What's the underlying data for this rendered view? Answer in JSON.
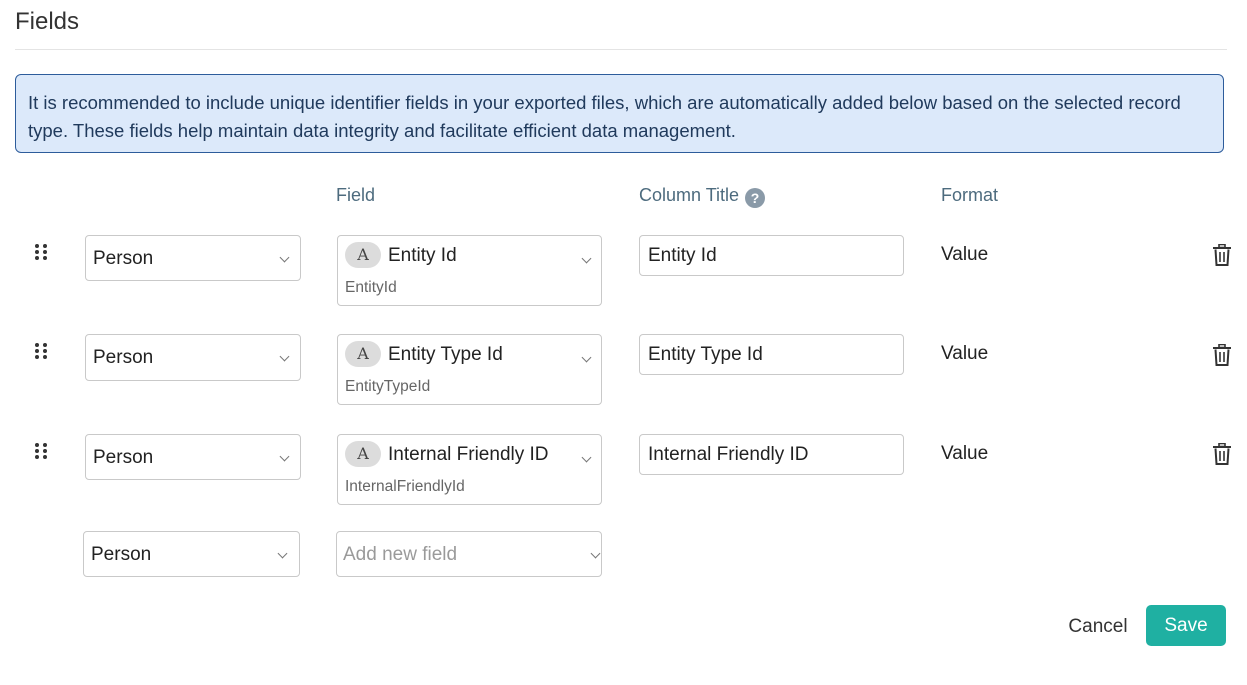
{
  "page_title": "Fields",
  "info_message": "It is recommended to include unique identifier fields in your exported files, which are automatically added below based on the selected record type. These fields help maintain data integrity and facilitate efficient data management.",
  "headers": {
    "field": "Field",
    "column_title": "Column Title",
    "format": "Format"
  },
  "rows": [
    {
      "record_type": "Person",
      "type_badge": "A",
      "field_label": "Entity Id",
      "field_key": "EntityId",
      "column_title": "Entity Id",
      "format": "Value"
    },
    {
      "record_type": "Person",
      "type_badge": "A",
      "field_label": "Entity Type Id",
      "field_key": "EntityTypeId",
      "column_title": "Entity Type Id",
      "format": "Value"
    },
    {
      "record_type": "Person",
      "type_badge": "A",
      "field_label": "Internal Friendly ID",
      "field_key": "InternalFriendlyId",
      "column_title": "Internal Friendly ID",
      "format": "Value"
    }
  ],
  "new_row": {
    "record_type": "Person",
    "field_placeholder": "Add new field"
  },
  "buttons": {
    "cancel": "Cancel",
    "save": "Save"
  },
  "colors": {
    "accent": "#1fb0a2",
    "info_background": "#dce9fa",
    "info_border": "#2d5c9b"
  },
  "icons": {
    "help": "question-circle-icon",
    "drag": "drag-handle-icon",
    "delete": "trash-icon",
    "dropdown": "chevron-down-icon"
  }
}
